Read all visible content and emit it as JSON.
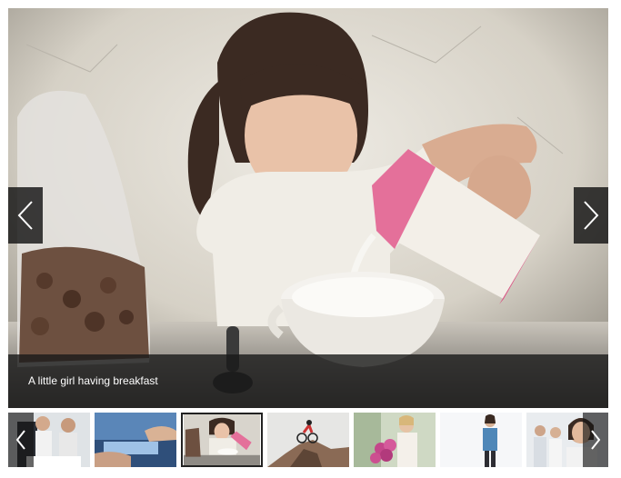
{
  "slide": {
    "caption": "A little girl having breakfast",
    "image": "girl-pouring-milk-into-cereal-bowl"
  },
  "icons": {
    "prev": "chevron-left-icon",
    "next": "chevron-right-icon"
  },
  "thumbnails": [
    {
      "image": "business-people-meeting",
      "active": false
    },
    {
      "image": "hands-typing-on-laptop",
      "active": false
    },
    {
      "image": "girl-having-breakfast",
      "active": true
    },
    {
      "image": "mountain-biker",
      "active": false
    },
    {
      "image": "woman-with-flowers",
      "active": false
    },
    {
      "image": "woman-in-denim-shirt",
      "active": false
    },
    {
      "image": "smiling-business-team",
      "active": false
    }
  ],
  "colors": {
    "caption_bar": "#191919",
    "arrow_bg": "#141414",
    "active_thumb_border": "#222222"
  }
}
